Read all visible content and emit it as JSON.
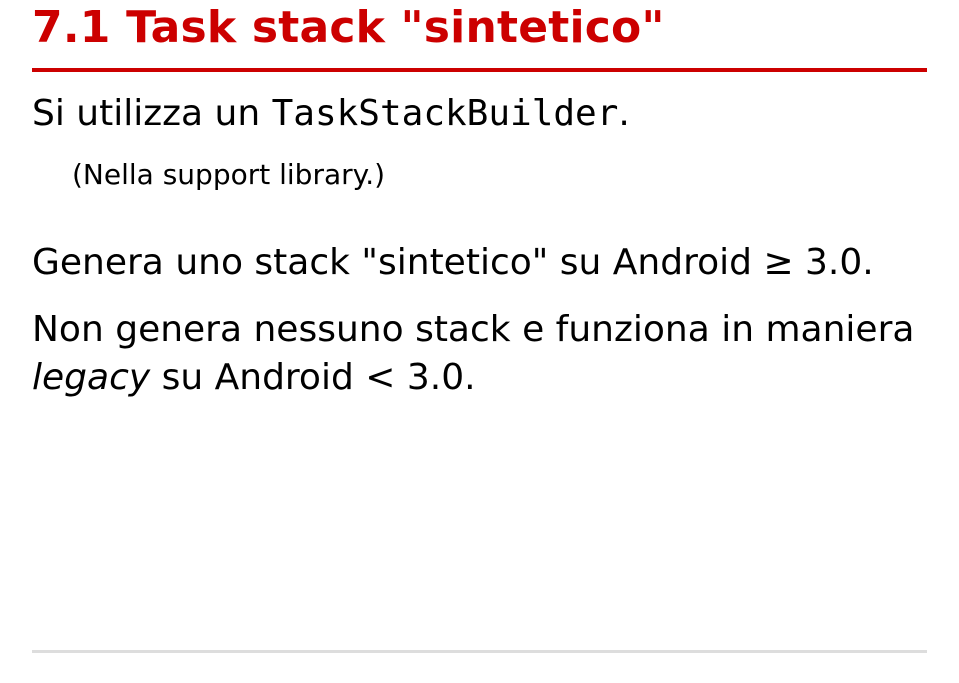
{
  "slide": {
    "title": "7.1 Task stack \"sintetico\"",
    "line1_prefix": "Si utilizza un ",
    "line1_code": "TaskStackBuilder",
    "line1_suffix": ".",
    "note": "(Nella support library.)",
    "para2": "Genera uno stack \"sintetico\" su Android ≥ 3.0.",
    "para3_a": "Non genera nessuno stack e funziona in maniera ",
    "para3_italic": "legacy",
    "para3_b": " su Android < 3.0."
  }
}
